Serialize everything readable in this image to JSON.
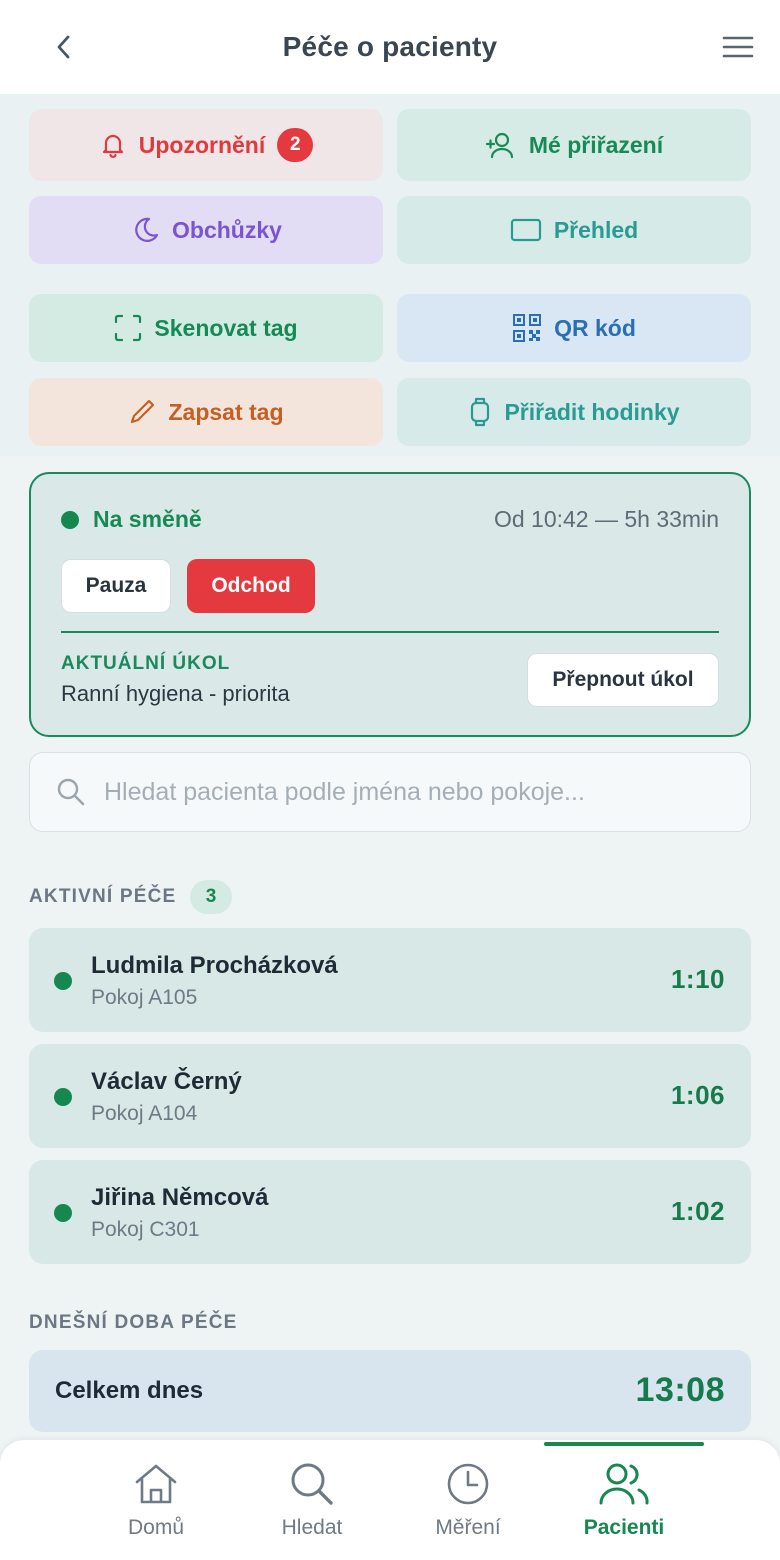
{
  "header": {
    "title": "Péče o pacienty",
    "back_icon": "chevron-left-icon",
    "menu_icon": "hamburger-menu-icon"
  },
  "actions": {
    "alerts": {
      "label": "Upozornění",
      "count": "2",
      "icon": "bell-icon",
      "color": "#e0393e"
    },
    "assignments": {
      "label": "Mé přiřazení",
      "icon": "user-plus-icon",
      "color": "#188a58"
    },
    "rounds": {
      "label": "Obchůzky",
      "icon": "moon-icon",
      "color": "#7b55cf"
    },
    "overview": {
      "label": "Přehled",
      "icon": "rectangle-icon",
      "color": "#2a9a92"
    },
    "scan_tag": {
      "label": "Skenovat tag",
      "icon": "scan-frame-icon",
      "color": "#158a55"
    },
    "qr_code": {
      "label": "QR kód",
      "icon": "qr-code-icon",
      "color": "#2a6fb5"
    },
    "write_tag": {
      "label": "Zapsat tag",
      "icon": "pencil-icon",
      "color": "#c55f22"
    },
    "assign_watch": {
      "label": "Přiřadit hodinky",
      "icon": "watch-icon",
      "color": "#2a9a92"
    }
  },
  "shift": {
    "status": "Na směně",
    "since": "Od 10:42 — 5h 33min",
    "pause_label": "Pauza",
    "leave_label": "Odchod",
    "task_caption": "AKTUÁLNÍ ÚKOL",
    "task_name": "Ranní hygiena - priorita",
    "switch_label": "Přepnout úkol"
  },
  "search": {
    "placeholder": "Hledat pacienta podle jména nebo pokoje...",
    "value": ""
  },
  "active_care": {
    "title": "AKTIVNÍ PÉČE",
    "count": "3",
    "patients": [
      {
        "name": "Ludmila Procházková",
        "room": "Pokoj A105",
        "time": "1:10"
      },
      {
        "name": "Václav Černý",
        "room": "Pokoj A104",
        "time": "1:06"
      },
      {
        "name": "Jiřina Němcová",
        "room": "Pokoj C301",
        "time": "1:02"
      }
    ]
  },
  "today": {
    "title": "DNEŠNÍ DOBA PÉČE",
    "total_label": "Celkem dnes",
    "total_value": "13:08"
  },
  "nav": {
    "items": [
      {
        "label": "Domů",
        "icon": "home-icon"
      },
      {
        "label": "Hledat",
        "icon": "search-icon"
      },
      {
        "label": "Měření",
        "icon": "clock-icon"
      },
      {
        "label": "Pacienti",
        "icon": "users-icon"
      }
    ],
    "active": "Pacienti"
  },
  "colors": {
    "brand_green": "#16884f",
    "danger_red": "#e43a3f"
  }
}
